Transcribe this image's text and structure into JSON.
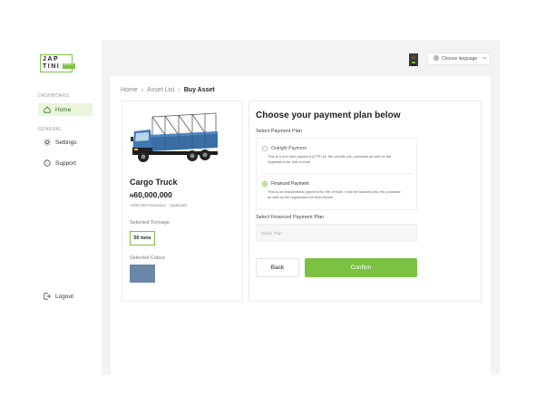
{
  "logo": {
    "line1": "JAP",
    "line2": "TINI",
    "tag": "FREIGHT"
  },
  "sidebar": {
    "section_dashboard": "DASHBOARD",
    "section_general": "GENERAL",
    "items": [
      {
        "label": "Home",
        "icon": "home-icon",
        "active": true
      },
      {
        "label": "Settings",
        "icon": "gear-icon"
      },
      {
        "label": "Support",
        "icon": "chat-icon"
      }
    ],
    "logout": "Logout"
  },
  "header": {
    "language_label": "Choose language"
  },
  "breadcrumb": {
    "home": "Home",
    "asset_list": "Asset List",
    "current": "Buy Asset",
    "separator": "›"
  },
  "asset": {
    "name": "Cargo Truck",
    "currency": "₦",
    "price": "60,000,000",
    "insurance": "+200,000 Insurance",
    "insurance_note": "(optional)",
    "tonnage_label": "Selected Tonnage",
    "tonnage_value": "50 tons",
    "colour_label": "Selected Colour",
    "colour_hex": "#6b86a8"
  },
  "payment": {
    "title": "Choose your payment plan below",
    "plan_label": "Select Payment Plan",
    "plans": [
      {
        "title": "Outright Payment",
        "desc": "This is a one time payment (OTP) for the vechile you purchase as well as the registration for that vechile",
        "selected": false
      },
      {
        "title": "Financed Payment",
        "desc": "This is an installmental payment for the vehicle, it will be factored into the purchase as well as the registration for that vechile",
        "selected": true
      }
    ],
    "financed_label": "Select Financed Payment Plan",
    "select_placeholder": "Select Plan",
    "back_label": "Back",
    "confirm_label": "Confirm"
  },
  "colors": {
    "accent": "#7cc242",
    "background": "#f3f3f3"
  }
}
